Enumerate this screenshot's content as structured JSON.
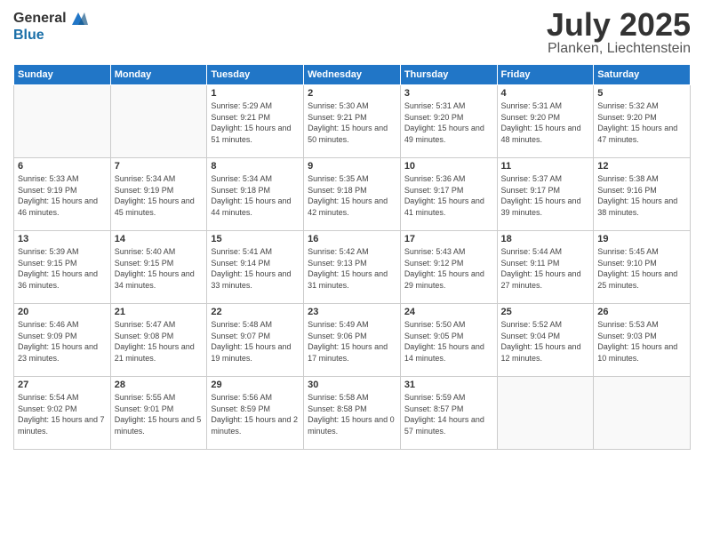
{
  "logo": {
    "general": "General",
    "blue": "Blue"
  },
  "title": {
    "month_year": "July 2025",
    "location": "Planken, Liechtenstein"
  },
  "weekdays": [
    "Sunday",
    "Monday",
    "Tuesday",
    "Wednesday",
    "Thursday",
    "Friday",
    "Saturday"
  ],
  "weeks": [
    [
      {
        "day": "",
        "sunrise": "",
        "sunset": "",
        "daylight": ""
      },
      {
        "day": "",
        "sunrise": "",
        "sunset": "",
        "daylight": ""
      },
      {
        "day": "1",
        "sunrise": "Sunrise: 5:29 AM",
        "sunset": "Sunset: 9:21 PM",
        "daylight": "Daylight: 15 hours and 51 minutes."
      },
      {
        "day": "2",
        "sunrise": "Sunrise: 5:30 AM",
        "sunset": "Sunset: 9:21 PM",
        "daylight": "Daylight: 15 hours and 50 minutes."
      },
      {
        "day": "3",
        "sunrise": "Sunrise: 5:31 AM",
        "sunset": "Sunset: 9:20 PM",
        "daylight": "Daylight: 15 hours and 49 minutes."
      },
      {
        "day": "4",
        "sunrise": "Sunrise: 5:31 AM",
        "sunset": "Sunset: 9:20 PM",
        "daylight": "Daylight: 15 hours and 48 minutes."
      },
      {
        "day": "5",
        "sunrise": "Sunrise: 5:32 AM",
        "sunset": "Sunset: 9:20 PM",
        "daylight": "Daylight: 15 hours and 47 minutes."
      }
    ],
    [
      {
        "day": "6",
        "sunrise": "Sunrise: 5:33 AM",
        "sunset": "Sunset: 9:19 PM",
        "daylight": "Daylight: 15 hours and 46 minutes."
      },
      {
        "day": "7",
        "sunrise": "Sunrise: 5:34 AM",
        "sunset": "Sunset: 9:19 PM",
        "daylight": "Daylight: 15 hours and 45 minutes."
      },
      {
        "day": "8",
        "sunrise": "Sunrise: 5:34 AM",
        "sunset": "Sunset: 9:18 PM",
        "daylight": "Daylight: 15 hours and 44 minutes."
      },
      {
        "day": "9",
        "sunrise": "Sunrise: 5:35 AM",
        "sunset": "Sunset: 9:18 PM",
        "daylight": "Daylight: 15 hours and 42 minutes."
      },
      {
        "day": "10",
        "sunrise": "Sunrise: 5:36 AM",
        "sunset": "Sunset: 9:17 PM",
        "daylight": "Daylight: 15 hours and 41 minutes."
      },
      {
        "day": "11",
        "sunrise": "Sunrise: 5:37 AM",
        "sunset": "Sunset: 9:17 PM",
        "daylight": "Daylight: 15 hours and 39 minutes."
      },
      {
        "day": "12",
        "sunrise": "Sunrise: 5:38 AM",
        "sunset": "Sunset: 9:16 PM",
        "daylight": "Daylight: 15 hours and 38 minutes."
      }
    ],
    [
      {
        "day": "13",
        "sunrise": "Sunrise: 5:39 AM",
        "sunset": "Sunset: 9:15 PM",
        "daylight": "Daylight: 15 hours and 36 minutes."
      },
      {
        "day": "14",
        "sunrise": "Sunrise: 5:40 AM",
        "sunset": "Sunset: 9:15 PM",
        "daylight": "Daylight: 15 hours and 34 minutes."
      },
      {
        "day": "15",
        "sunrise": "Sunrise: 5:41 AM",
        "sunset": "Sunset: 9:14 PM",
        "daylight": "Daylight: 15 hours and 33 minutes."
      },
      {
        "day": "16",
        "sunrise": "Sunrise: 5:42 AM",
        "sunset": "Sunset: 9:13 PM",
        "daylight": "Daylight: 15 hours and 31 minutes."
      },
      {
        "day": "17",
        "sunrise": "Sunrise: 5:43 AM",
        "sunset": "Sunset: 9:12 PM",
        "daylight": "Daylight: 15 hours and 29 minutes."
      },
      {
        "day": "18",
        "sunrise": "Sunrise: 5:44 AM",
        "sunset": "Sunset: 9:11 PM",
        "daylight": "Daylight: 15 hours and 27 minutes."
      },
      {
        "day": "19",
        "sunrise": "Sunrise: 5:45 AM",
        "sunset": "Sunset: 9:10 PM",
        "daylight": "Daylight: 15 hours and 25 minutes."
      }
    ],
    [
      {
        "day": "20",
        "sunrise": "Sunrise: 5:46 AM",
        "sunset": "Sunset: 9:09 PM",
        "daylight": "Daylight: 15 hours and 23 minutes."
      },
      {
        "day": "21",
        "sunrise": "Sunrise: 5:47 AM",
        "sunset": "Sunset: 9:08 PM",
        "daylight": "Daylight: 15 hours and 21 minutes."
      },
      {
        "day": "22",
        "sunrise": "Sunrise: 5:48 AM",
        "sunset": "Sunset: 9:07 PM",
        "daylight": "Daylight: 15 hours and 19 minutes."
      },
      {
        "day": "23",
        "sunrise": "Sunrise: 5:49 AM",
        "sunset": "Sunset: 9:06 PM",
        "daylight": "Daylight: 15 hours and 17 minutes."
      },
      {
        "day": "24",
        "sunrise": "Sunrise: 5:50 AM",
        "sunset": "Sunset: 9:05 PM",
        "daylight": "Daylight: 15 hours and 14 minutes."
      },
      {
        "day": "25",
        "sunrise": "Sunrise: 5:52 AM",
        "sunset": "Sunset: 9:04 PM",
        "daylight": "Daylight: 15 hours and 12 minutes."
      },
      {
        "day": "26",
        "sunrise": "Sunrise: 5:53 AM",
        "sunset": "Sunset: 9:03 PM",
        "daylight": "Daylight: 15 hours and 10 minutes."
      }
    ],
    [
      {
        "day": "27",
        "sunrise": "Sunrise: 5:54 AM",
        "sunset": "Sunset: 9:02 PM",
        "daylight": "Daylight: 15 hours and 7 minutes."
      },
      {
        "day": "28",
        "sunrise": "Sunrise: 5:55 AM",
        "sunset": "Sunset: 9:01 PM",
        "daylight": "Daylight: 15 hours and 5 minutes."
      },
      {
        "day": "29",
        "sunrise": "Sunrise: 5:56 AM",
        "sunset": "Sunset: 8:59 PM",
        "daylight": "Daylight: 15 hours and 2 minutes."
      },
      {
        "day": "30",
        "sunrise": "Sunrise: 5:58 AM",
        "sunset": "Sunset: 8:58 PM",
        "daylight": "Daylight: 15 hours and 0 minutes."
      },
      {
        "day": "31",
        "sunrise": "Sunrise: 5:59 AM",
        "sunset": "Sunset: 8:57 PM",
        "daylight": "Daylight: 14 hours and 57 minutes."
      },
      {
        "day": "",
        "sunrise": "",
        "sunset": "",
        "daylight": ""
      },
      {
        "day": "",
        "sunrise": "",
        "sunset": "",
        "daylight": ""
      }
    ]
  ]
}
